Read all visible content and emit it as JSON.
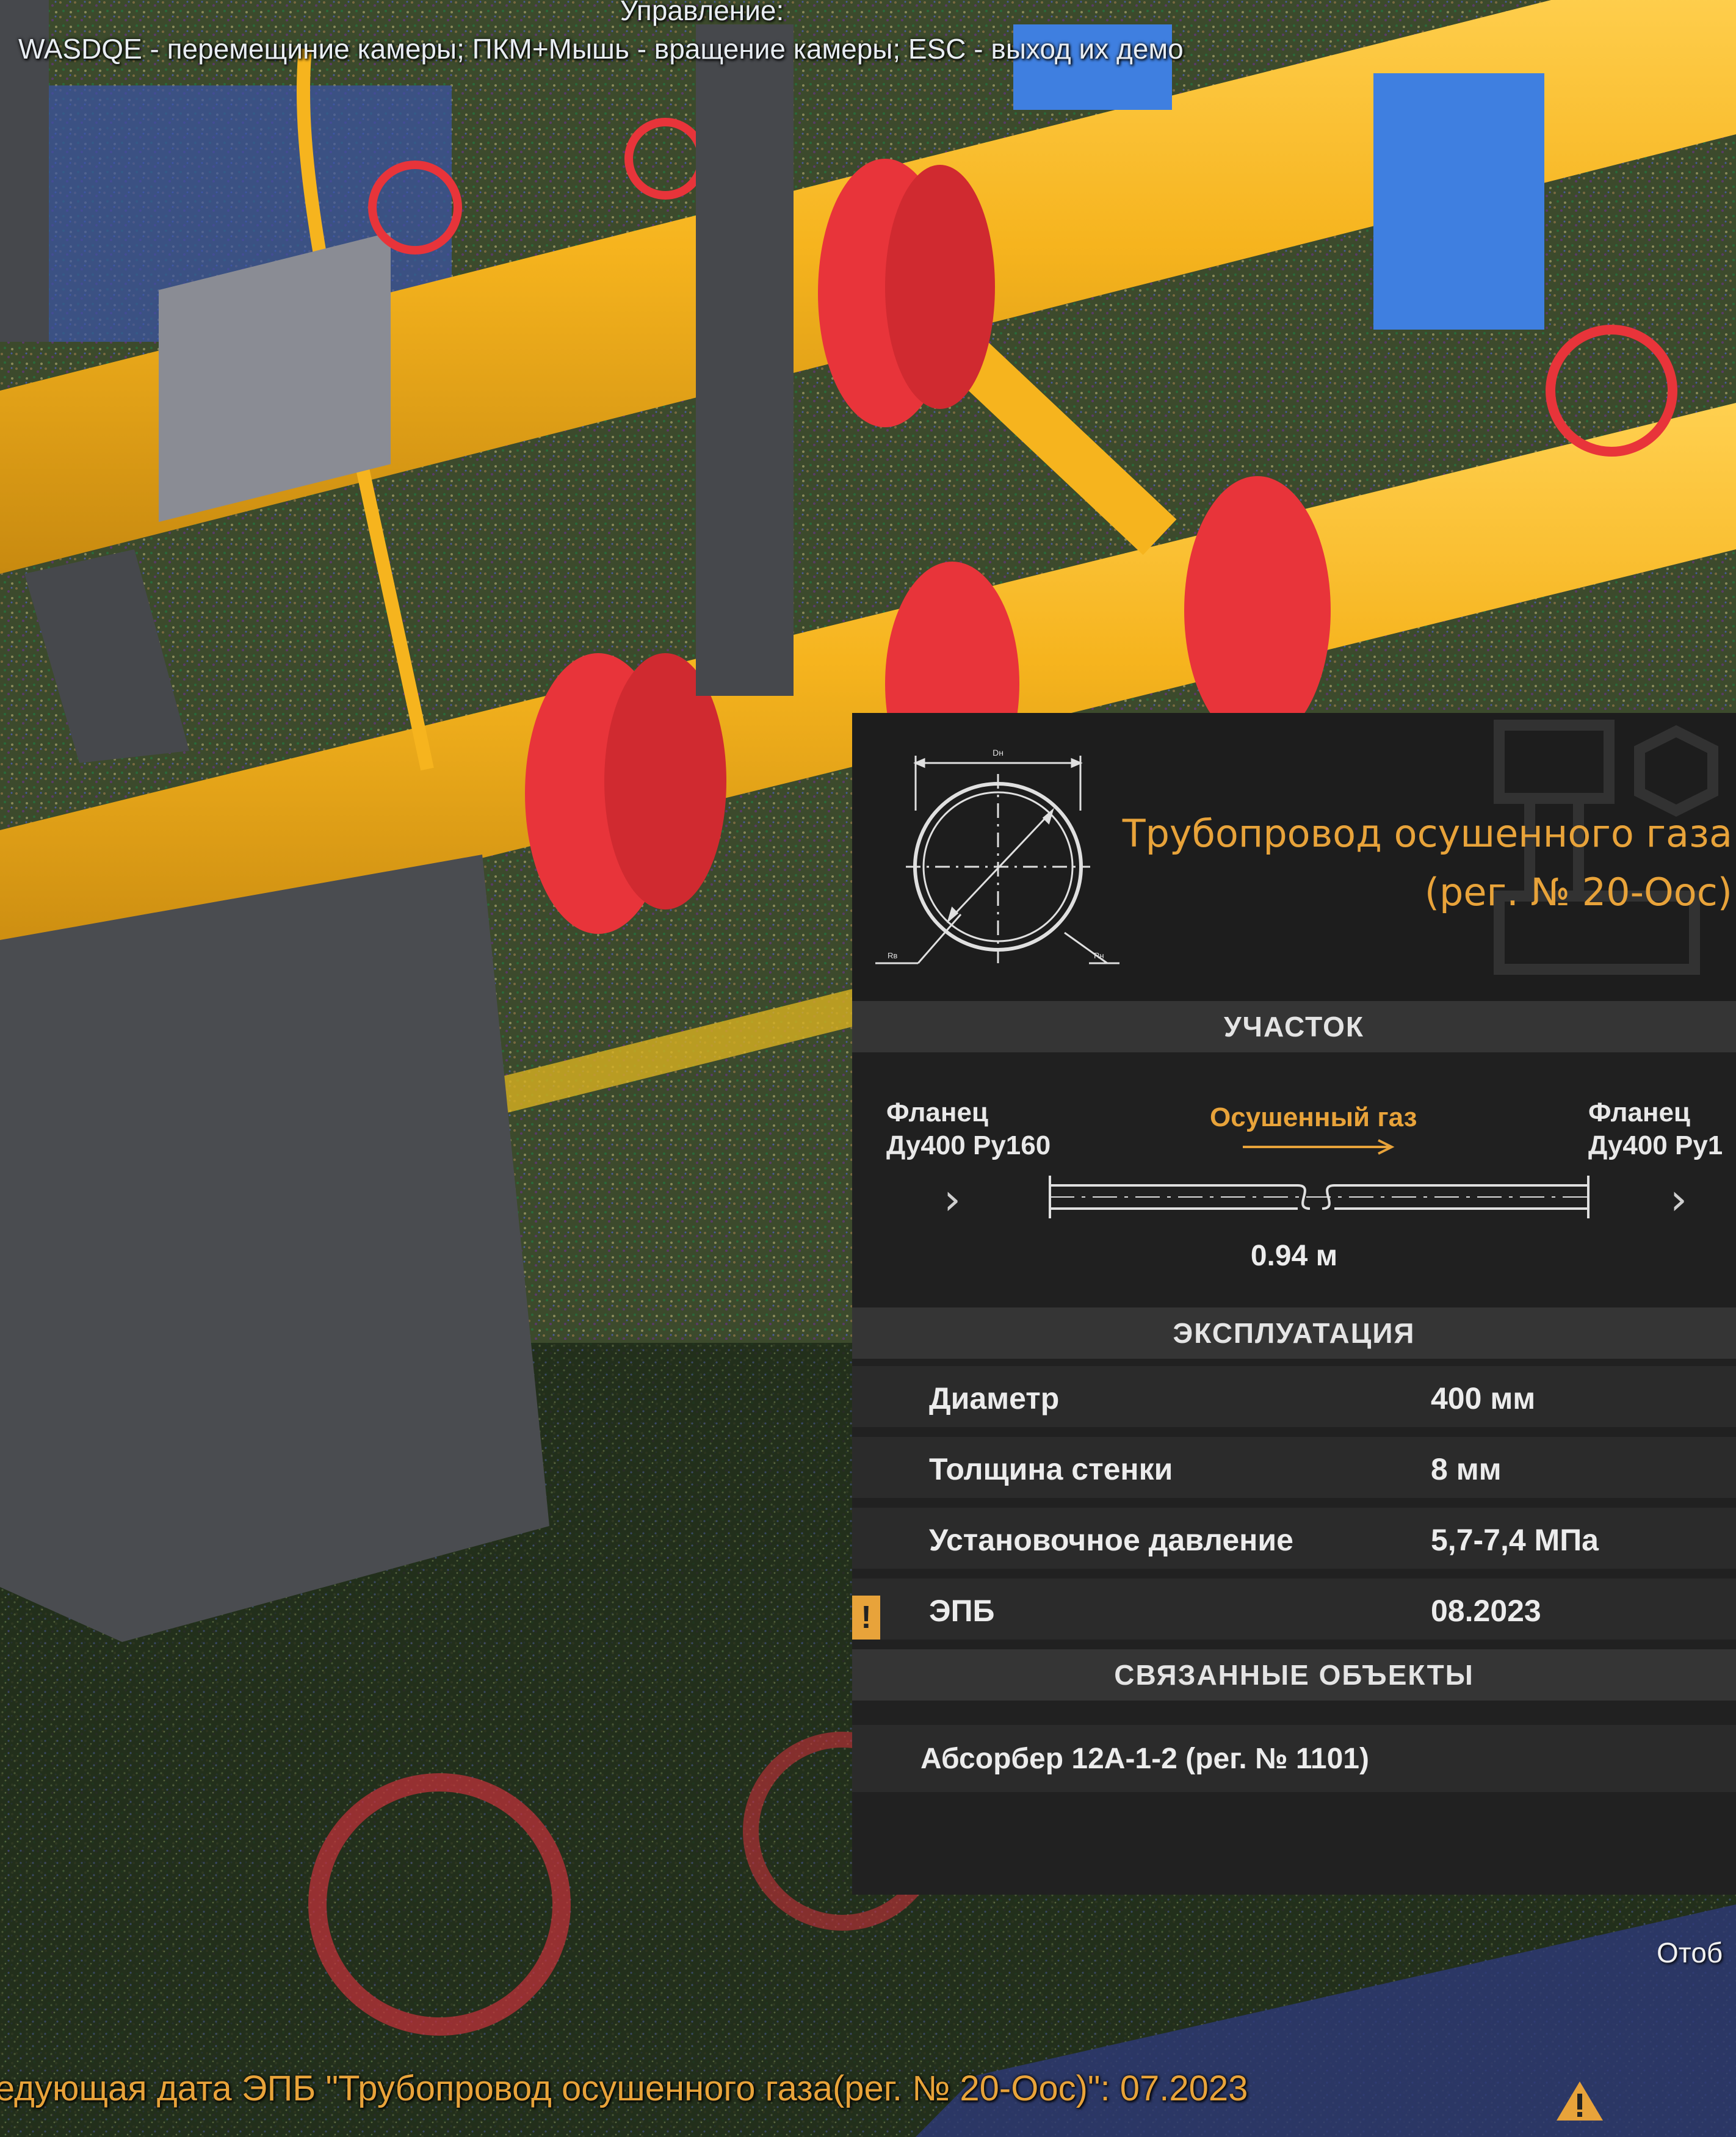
{
  "hint": {
    "title": "Управление:",
    "controls": "WASDQE - перемещиние камеры; ПКМ+Мышь - вращение камеры; ESC - выход их демо"
  },
  "panel": {
    "title_line1": "Трубопровод осушенного газа",
    "title_line2": "(рег. № 20-Оос)",
    "segment": {
      "header": "УЧАСТОК",
      "left_label1": "Фланец",
      "left_label2": "Ду400 Ру160",
      "right_label1": "Фланец",
      "right_label2": "Ду400 Ру1",
      "flow": "Осушенный газ",
      "length": "0.94 м"
    },
    "operation": {
      "header": "ЭКСПЛУАТАЦИЯ",
      "rows": [
        {
          "key": "Диаметр",
          "value": "400 мм"
        },
        {
          "key": "Толщина стенки",
          "value": "8 мм"
        },
        {
          "key": "Установочное давление",
          "value": "5,7-7,4 МПа"
        },
        {
          "key": "ЭПБ",
          "value": "08.2023",
          "warning": "!"
        }
      ]
    },
    "related": {
      "header": "СВЯЗАННЫЕ ОБЪЕКТЫ",
      "items": [
        "Абсорбер 12А-1-2 (рег. № 1101)"
      ]
    }
  },
  "right_label": "Отоб",
  "bottom_message": "едующая дата ЭПБ \"Трубопровод осушенного газа(рег. № 20-Оос)\":  07.2023",
  "colors": {
    "accent": "#e8a33a",
    "pipe": "#f6b41e",
    "flange": "#e8343a",
    "panel_bg": "#212121",
    "section_bg": "#353535"
  },
  "icons": [
    "warning-icon",
    "chevron-left-icon",
    "chevron-right-icon",
    "pipe-section-icon"
  ]
}
